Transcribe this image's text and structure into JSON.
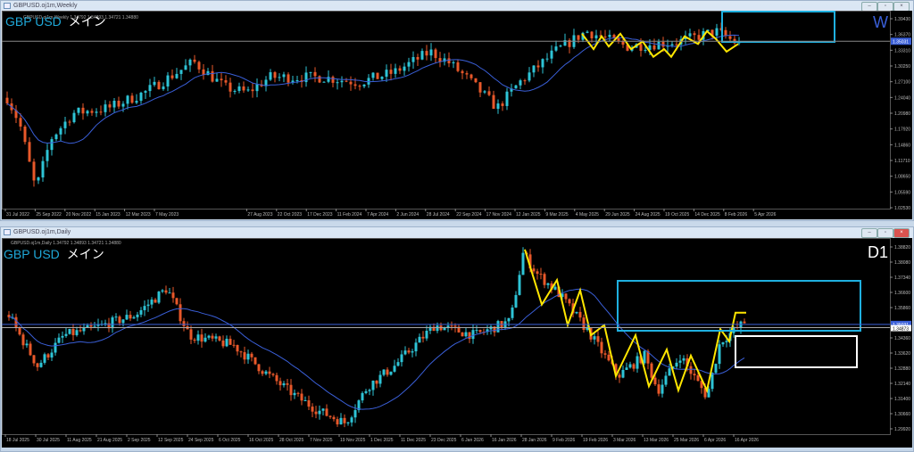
{
  "weekly": {
    "title": "GBPUSD.oj1m,Weekly",
    "ohlc": "GBPUSD.oj1m,Weekly  1.34792 1.34893 1.34721 1.34880",
    "symbol": "GBP USD",
    "label": "メイン",
    "timeframe": "W",
    "price_ticks": [
      "1.39430",
      "1.36370",
      "1.33310",
      "1.30250",
      "1.27100",
      "1.24040",
      "1.20980",
      "1.17920",
      "1.14860",
      "1.11710",
      "1.08650",
      "1.05590",
      "1.02530"
    ],
    "current_price": "1.35031",
    "time_ticks": [
      "31 Jul 2022",
      "25 Sep 2022",
      "20 Nov 2022",
      "15 Jan 2023",
      "12 Mar 2023",
      "7 May 2023",
      "27 Aug 2023",
      "22 Oct 2023",
      "17 Dec 2023",
      "11 Feb 2024",
      "7 Apr 2024",
      "2 Jun 2024",
      "28 Jul 2024",
      "22 Sep 2024",
      "17 Nov 2024",
      "12 Jan 2025",
      "9 Mar 2025",
      "4 May 2025",
      "29 Jun 2025",
      "24 Aug 2025",
      "19 Oct 2025",
      "14 Dec 2025",
      "8 Feb 2026",
      "5 Apr 2026"
    ]
  },
  "daily": {
    "title": "GBPUSD.oj1m,Daily",
    "ohlc": "GBPUSD.oj1m,Daily  1.34792 1.34893 1.34721 1.34880",
    "symbol": "GBP USD",
    "label": "メイン",
    "timeframe": "D1",
    "price_ticks": [
      "1.38820",
      "1.38080",
      "1.37340",
      "1.36600",
      "1.35860",
      "1.34360",
      "1.33620",
      "1.32880",
      "1.32140",
      "1.31400",
      "1.30660",
      "1.29920"
    ],
    "current_price": "1.35031",
    "bid_price": "1.34873",
    "time_ticks": [
      "18 Jul 2025",
      "30 Jul 2025",
      "11 Aug 2025",
      "21 Aug 2025",
      "2 Sep 2025",
      "12 Sep 2025",
      "24 Sep 2025",
      "6 Oct 2025",
      "16 Oct 2025",
      "28 Oct 2025",
      "7 Nov 2025",
      "19 Nov 2025",
      "1 Dec 2025",
      "11 Dec 2025",
      "23 Dec 2025",
      "6 Jan 2026",
      "16 Jan 2026",
      "28 Jan 2026",
      "9 Feb 2026",
      "19 Feb 2026",
      "3 Mar 2026",
      "13 Mar 2026",
      "25 Mar 2026",
      "6 Apr 2026",
      "16 Apr 2026"
    ]
  },
  "colors": {
    "up": "#2ec4d6",
    "down": "#e8582a",
    "ma": "#3a5fd8",
    "zigzag": "#ffe600",
    "box": "#1fb0e0"
  }
}
